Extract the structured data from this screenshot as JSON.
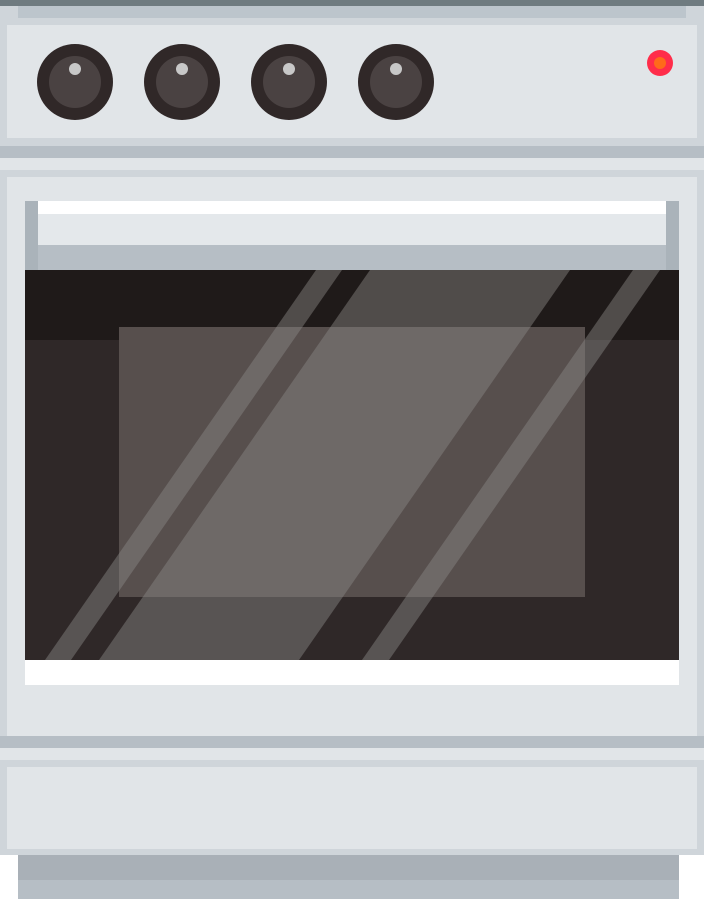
{
  "illustration": {
    "subject": "oven-stove",
    "colors": {
      "body": "#e1e5e8",
      "body_edge": "#cfd5da",
      "trim": "#b6bec5",
      "trim_dark": "#a9b0b7",
      "top_strip": "#6f7b80",
      "knob_outer": "#302828",
      "knob_inner": "#4a4242",
      "knob_dot": "#c8c8c8",
      "indicator_ring": "#ff2d4a",
      "indicator_core": "#ff6a1a",
      "window_dark": "#2f2828",
      "window_top": "#1f1a19",
      "rack": "#574f4d",
      "glare": "#8c8a88"
    },
    "knobs": [
      {
        "name": "knob-1"
      },
      {
        "name": "knob-2"
      },
      {
        "name": "knob-3"
      },
      {
        "name": "knob-4"
      }
    ],
    "indicator": {
      "state": "on"
    }
  }
}
